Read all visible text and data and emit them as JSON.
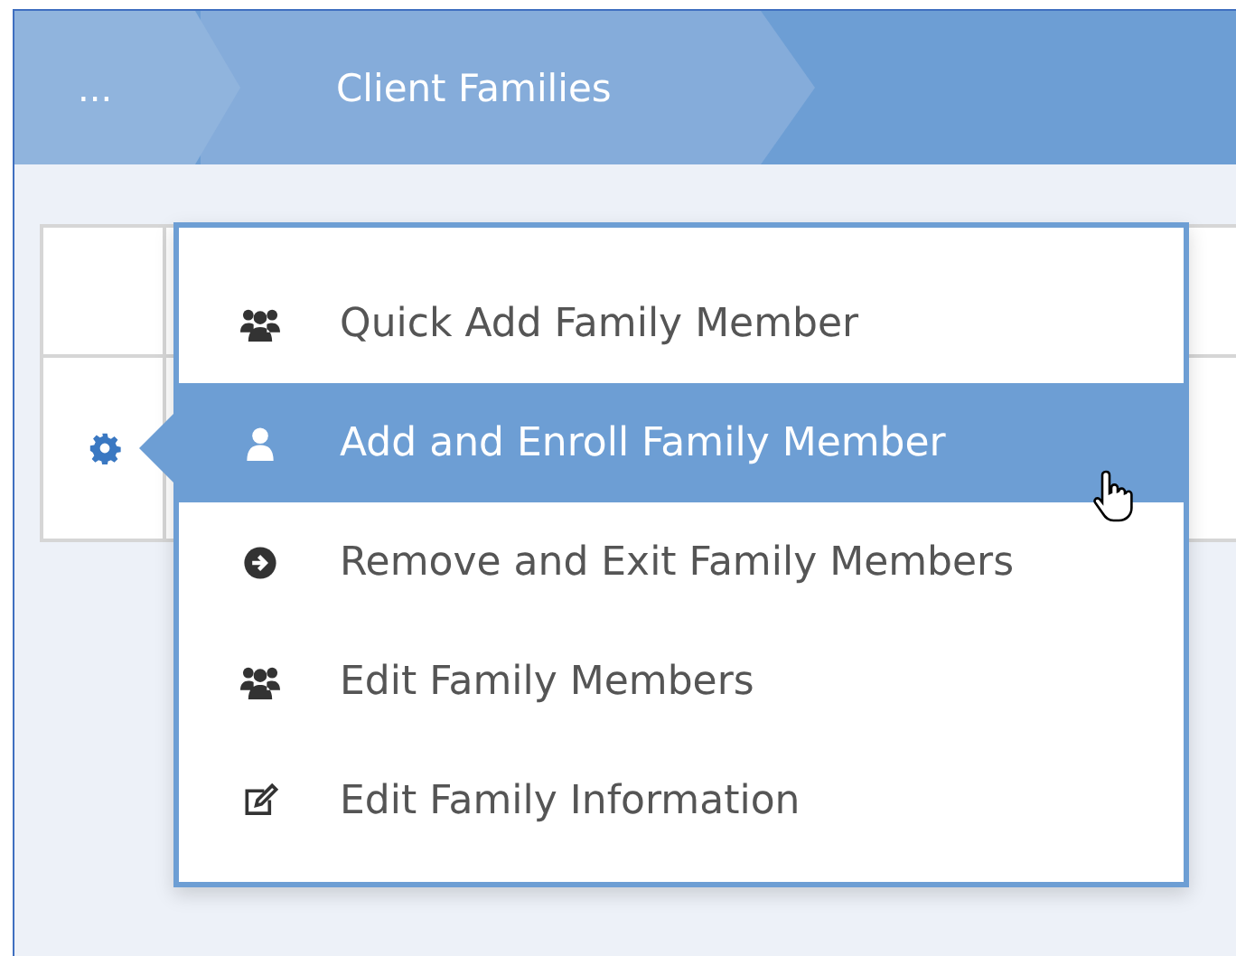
{
  "breadcrumbs": [
    {
      "label": "..."
    },
    {
      "label": "Client Families"
    }
  ],
  "table": {
    "rows": [
      {
        "kind": "blank"
      },
      {
        "kind": "gear"
      }
    ]
  },
  "menu": {
    "items": [
      {
        "label": "Quick Add Family Member",
        "kind": "group",
        "selected": false
      },
      {
        "label": "Add and Enroll Family Member",
        "kind": "user",
        "selected": true
      },
      {
        "label": "Remove and Exit Family Members",
        "kind": "arrow",
        "selected": false
      },
      {
        "label": "Edit Family Members",
        "kind": "group",
        "selected": false
      },
      {
        "label": "Edit Family Information",
        "kind": "edit",
        "selected": false
      }
    ]
  }
}
